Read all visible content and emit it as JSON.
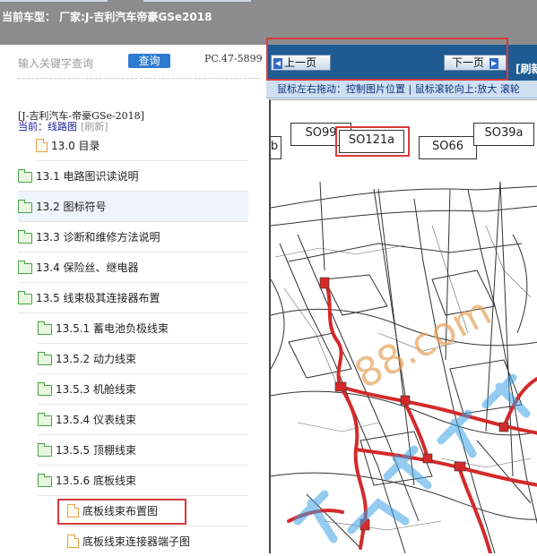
{
  "header": {
    "title": "当前车型：  厂家:J-吉利汽车帝豪GSe2018"
  },
  "search": {
    "hint": "输入关键字查询",
    "button": "查询",
    "pc_code": "PC.47-5899"
  },
  "vehicle": {
    "name": "[J-吉利汽车-帝豪GSe-2018]",
    "current_label": "当前：线路图",
    "refresh_label": "[刷新]"
  },
  "tree": [
    {
      "label": "13.0 目录"
    },
    {
      "label": "13.1 电路图识读说明"
    },
    {
      "label": "13.2 图标符号"
    },
    {
      "label": "13.3 诊断和维修方法说明"
    },
    {
      "label": "13.4 保险丝、继电器"
    },
    {
      "label": "13.5 线束极其连接器布置"
    },
    {
      "label": "13.5.1 蓄电池负极线束"
    },
    {
      "label": "13.5.2 动力线束"
    },
    {
      "label": "13.5.3 机舱线束"
    },
    {
      "label": "13.5.4 仪表线束"
    },
    {
      "label": "13.5.5 顶棚线束"
    },
    {
      "label": "13.5.6 底板线束"
    },
    {
      "label": "底板线束布置图"
    },
    {
      "label": "底板线束连接器端子图"
    }
  ],
  "viewer": {
    "prev_label": "上一页",
    "next_label": "下一页",
    "refresh_label": "[刷新",
    "hint": "鼠标左右拖动：控制图片位置 | 鼠标滚轮向上:放大  滚轮",
    "connector_labels": [
      "SO99",
      "SO121a",
      "SO66",
      "SO39a",
      "b"
    ],
    "watermark": "88.com"
  },
  "colors": {
    "header_bg": "#8c8c8c",
    "nav_bg": "#1e5b92",
    "accent": "#2e7cd0",
    "highlight_box": "#d83a3a",
    "harness": "#d42a2a"
  }
}
